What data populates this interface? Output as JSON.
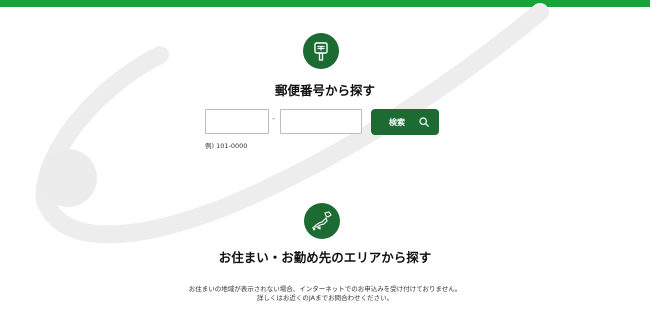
{
  "colors": {
    "brand_green": "#13a538",
    "button_green": "#1b6b33",
    "decor_gray": "#ececec"
  },
  "postal_section": {
    "icon": "postbox-icon",
    "heading": "郵便番号から探す",
    "zip_first": {
      "value": "",
      "placeholder": ""
    },
    "separator": "-",
    "zip_second": {
      "value": "",
      "placeholder": ""
    },
    "search_label": "検索",
    "search_icon": "search-icon",
    "example": "例) 101-0000"
  },
  "area_section": {
    "icon": "japan-map-icon",
    "heading": "お住まい・お勤め先のエリアから探す",
    "note_line1": "お住まいの地域が表示されない場合、インターネットでのお申込みを受け付けておりません。",
    "note_line2": "詳しくはお近くのJAまでお問合わせください。"
  }
}
